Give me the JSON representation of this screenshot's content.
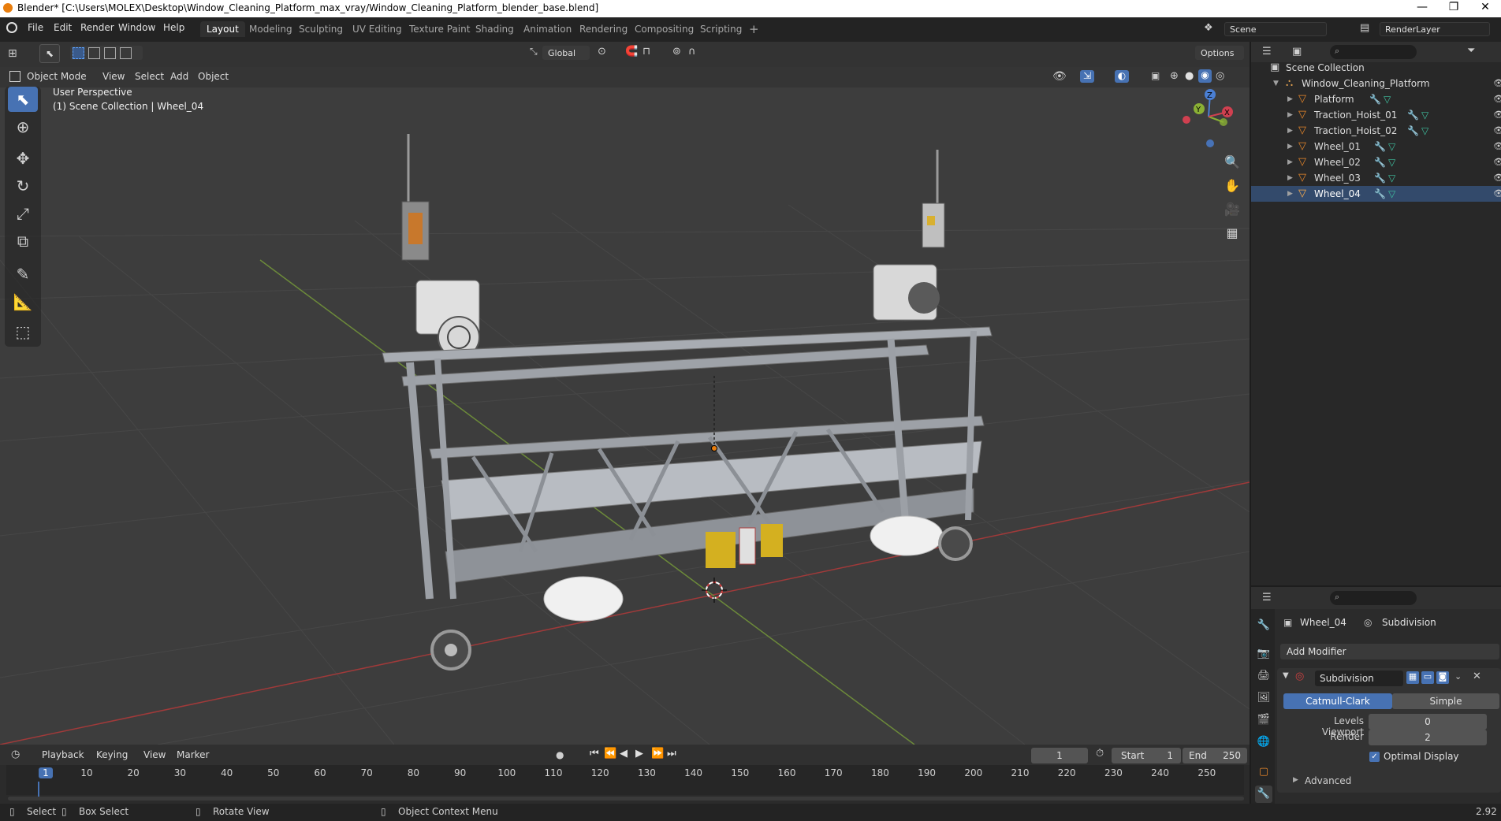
{
  "window": {
    "title": "Blender* [C:\\Users\\MOLEX\\Desktop\\Window_Cleaning_Platform_max_vray/Window_Cleaning_Platform_blender_base.blend]",
    "minimize": "—",
    "maximize": "❐",
    "close": "✕"
  },
  "menus": [
    "File",
    "Edit",
    "Render",
    "Window",
    "Help"
  ],
  "workspaces": [
    "Layout",
    "Modeling",
    "Sculpting",
    "UV Editing",
    "Texture Paint",
    "Shading",
    "Animation",
    "Rendering",
    "Compositing",
    "Scripting"
  ],
  "workspace_active": "Layout",
  "workspace_add": "+",
  "scene": {
    "label": "Scene",
    "renderlayer": "RenderLayer"
  },
  "viewport": {
    "transform_orientation": "Global",
    "options_label": "Options",
    "mode": "Object Mode",
    "menus": [
      "View",
      "Select",
      "Add",
      "Object"
    ],
    "overlay_line1": "User Perspective",
    "overlay_line2": "(1) Scene Collection | Wheel_04",
    "gizmo": {
      "x": "X",
      "y": "Y",
      "z": "Z"
    }
  },
  "outliner": {
    "root": "Scene Collection",
    "collection": "Window_Cleaning_Platform",
    "objects": [
      "Platform",
      "Traction_Hoist_01",
      "Traction_Hoist_02",
      "Wheel_01",
      "Wheel_02",
      "Wheel_03",
      "Wheel_04"
    ]
  },
  "properties": {
    "object_name": "Wheel_04",
    "modifier_context": "Subdivision",
    "add_modifier": "Add Modifier",
    "modifier_name": "Subdivision",
    "method_a": "Catmull-Clark",
    "method_b": "Simple",
    "levels_viewport_label": "Levels Viewport",
    "levels_viewport_value": "0",
    "render_label": "Render",
    "render_value": "2",
    "optimal_display": "Optimal Display",
    "optimal_display_checked": true,
    "advanced": "Advanced"
  },
  "timeline": {
    "menus": [
      "Playback",
      "Keying",
      "View",
      "Marker"
    ],
    "current_frame": "1",
    "start_label": "Start",
    "start_value": "1",
    "end_label": "End",
    "end_value": "250",
    "ticks": [
      "1",
      "10",
      "20",
      "30",
      "40",
      "50",
      "60",
      "70",
      "80",
      "90",
      "100",
      "110",
      "120",
      "130",
      "140",
      "150",
      "160",
      "170",
      "180",
      "190",
      "200",
      "210",
      "220",
      "230",
      "240",
      "250"
    ]
  },
  "statusbar": {
    "select": "Select",
    "box_select": "Box Select",
    "rotate_view": "Rotate View",
    "context_menu": "Object Context Menu",
    "version": "2.92"
  },
  "colors": {
    "accent": "#4772b3",
    "origin": "#e87d0d",
    "x_axis": "#b34040",
    "y_axis": "#7a9a40"
  }
}
